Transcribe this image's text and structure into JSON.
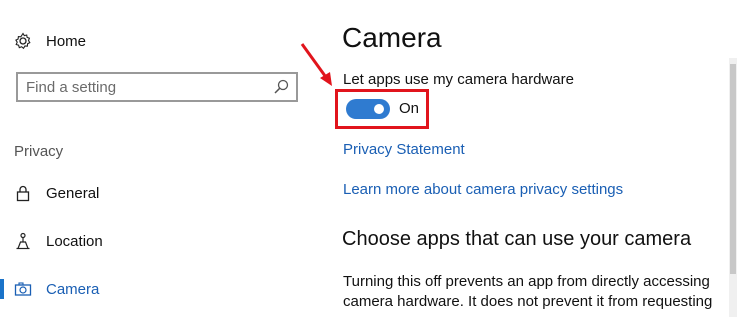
{
  "nav": {
    "home_label": "Home",
    "search_placeholder": "Find a setting",
    "section_label": "Privacy",
    "items": [
      {
        "label": "General",
        "icon": "lock-icon"
      },
      {
        "label": "Location",
        "icon": "location-icon"
      },
      {
        "label": "Camera",
        "icon": "camera-icon",
        "selected": true
      }
    ]
  },
  "main": {
    "title": "Camera",
    "setting_label": "Let apps use my camera hardware",
    "toggle_state": "On",
    "toggle_on": true,
    "links": [
      "Privacy Statement",
      "Learn more about camera privacy settings"
    ],
    "sub_heading": "Choose apps that can use your camera",
    "paragraph": "Turning this off prevents an app from directly accessing camera hardware. It does not prevent it from requesting"
  },
  "colors": {
    "accent": "#2f7bd0",
    "link": "#1a5fb4",
    "highlight": "#e1141c"
  }
}
